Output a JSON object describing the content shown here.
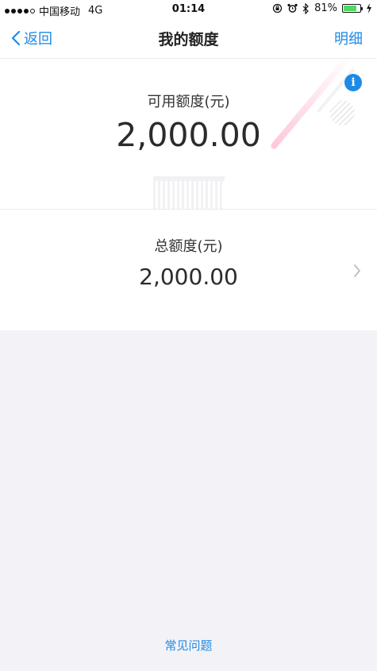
{
  "status_bar": {
    "carrier": "中国移动",
    "network": "4G",
    "time": "01:14",
    "battery": "81%",
    "battery_level": 0.81,
    "battery_color": "#4cd964"
  },
  "nav": {
    "back_label": "返回",
    "title": "我的额度",
    "detail_label": "明细"
  },
  "available": {
    "label": "可用额度(元)",
    "value": "2,000.00",
    "info_icon": "info-icon"
  },
  "total": {
    "label": "总额度(元)",
    "value": "2,000.00"
  },
  "footer": {
    "faq_label": "常见问题"
  },
  "colors": {
    "accent": "#1e8ae6",
    "background": "#f3f3f7"
  }
}
